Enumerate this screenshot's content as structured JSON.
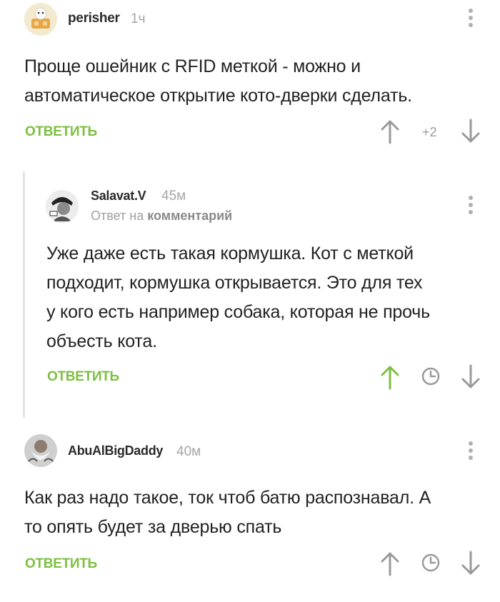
{
  "comments": [
    {
      "username": "perisher",
      "time": "1ч",
      "text_lines": [
        "Проще ошейник с RFID меткой - можно и",
        "автоматическое открытие кото-дверки сделать."
      ],
      "reply_label": "ОТВЕТИТЬ",
      "rating": "+2",
      "avatar": "doge-avatar"
    },
    {
      "username": "Salavat.V",
      "time": "45м",
      "reply_to_prefix": "Ответ на",
      "reply_to_link": "комментарий",
      "text_lines": [
        "Уже даже есть такая кормушка. Кот с меткой",
        "подходит, кормушка открывается. Это для тех",
        "у кого есть например собака, которая не прочь",
        "объесть кота."
      ],
      "reply_label": "ОТВЕТИТЬ",
      "avatar": "grayscale-avatar"
    },
    {
      "username": "AbuAlBigDaddy",
      "time": "40м",
      "text_lines": [
        "Как раз надо такое, ток чтоб батю распознавал. А",
        "то опять будет за дверью спать"
      ],
      "reply_label": "ОТВЕТИТЬ",
      "avatar": "bearded-man-avatar"
    }
  ],
  "colors": {
    "accent_green": "#7cc040",
    "icon_gray": "#9a9a9a",
    "text": "#222222",
    "muted": "#a6a6a6"
  }
}
